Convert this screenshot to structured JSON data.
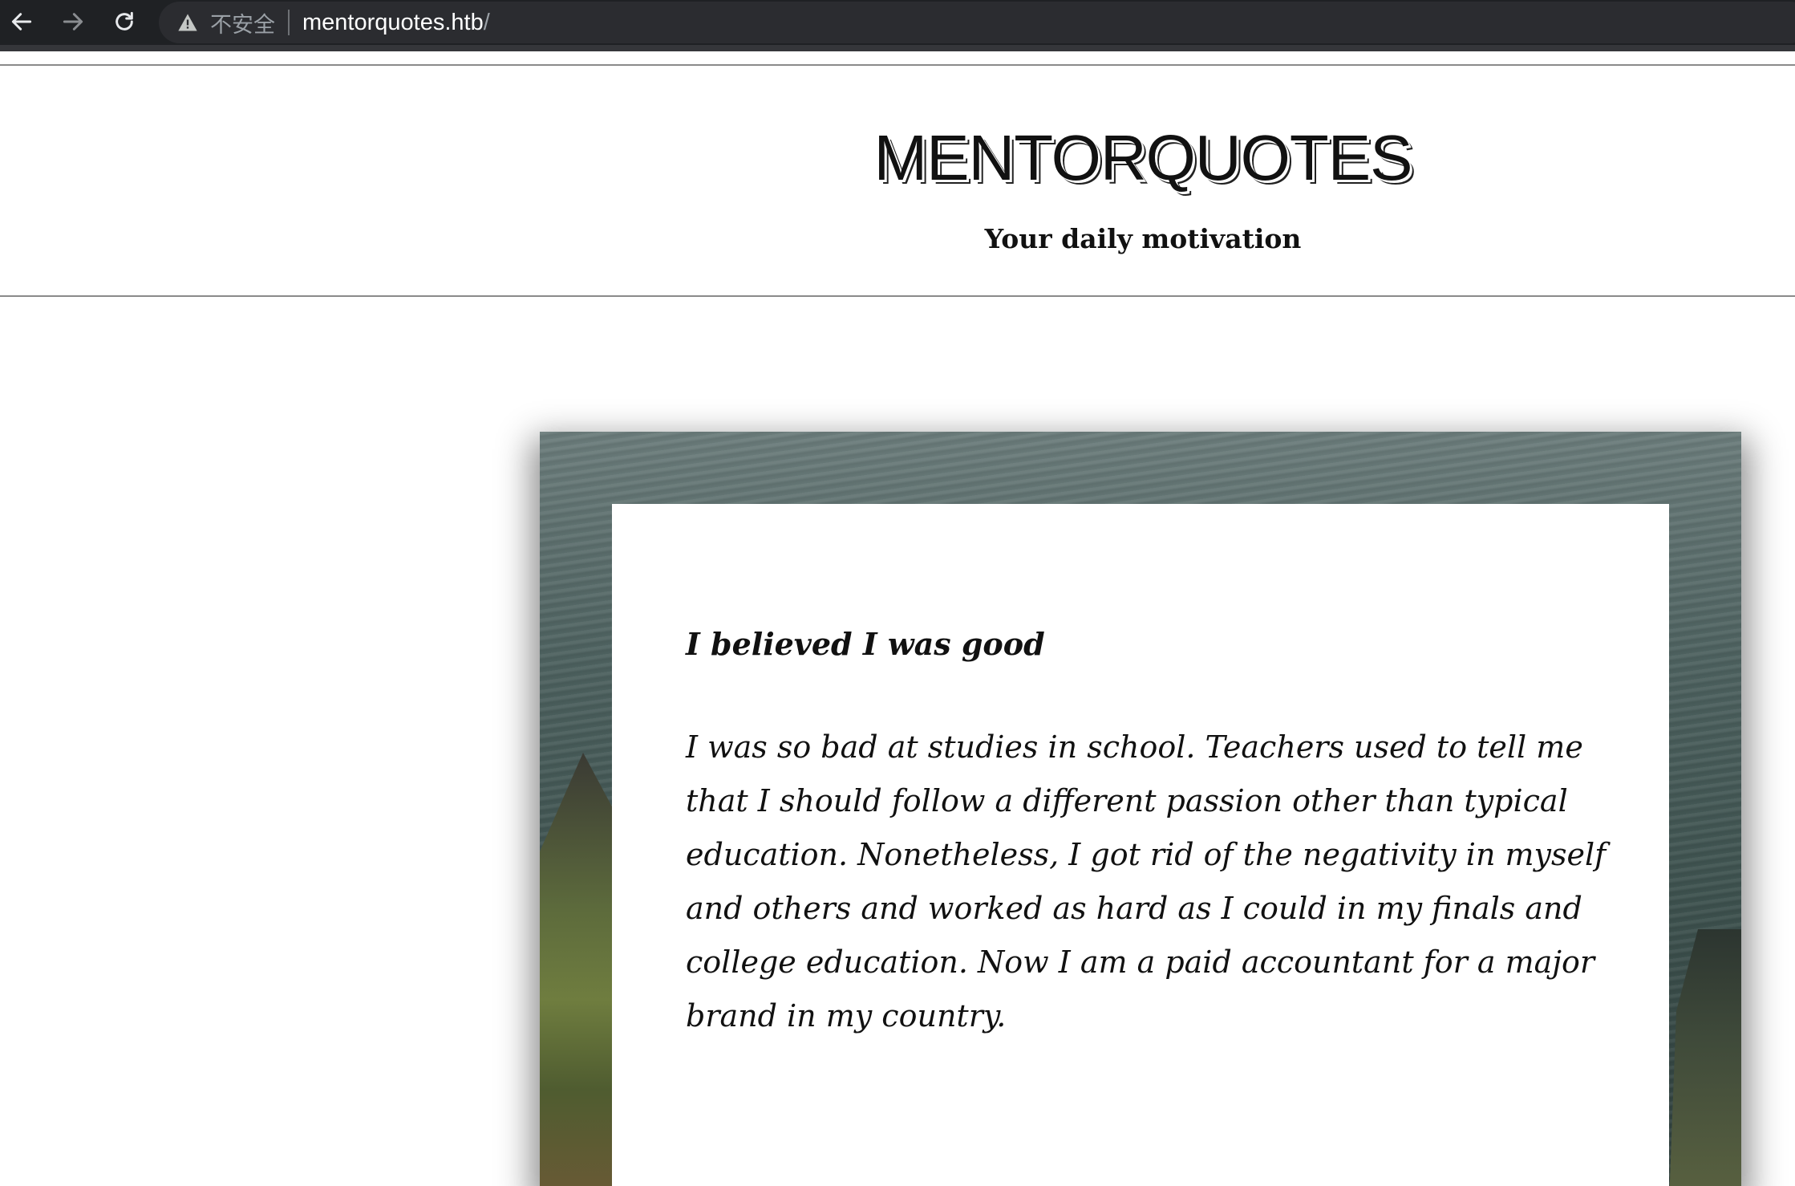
{
  "browser": {
    "security_label": "不安全",
    "url_host": "mentorquotes.htb",
    "url_path": "/",
    "icons": [
      "back-arrow-icon",
      "forward-arrow-icon",
      "reload-icon",
      "warning-icon"
    ]
  },
  "header": {
    "title": "MENTORQUOTES",
    "tagline": "Your daily motivation"
  },
  "quote": {
    "title": "I believed I was good",
    "body": "I was so bad at studies in school. Teachers used to tell me that I should follow a different passion other than typical education. Nonetheless, I got rid of the negativity in myself and others and worked as hard as I could in my finals and college education. Now I am a paid accountant for a major brand in my country.",
    "author_dash": "—"
  },
  "colors": {
    "chrome_bg": "#1f2124",
    "address_bg": "#2b2c30",
    "text_dark": "#111111",
    "rule": "#8a8a8a"
  }
}
